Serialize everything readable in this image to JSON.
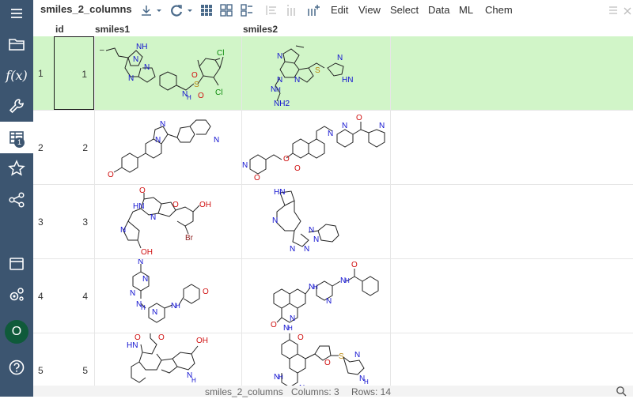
{
  "sidebar": {
    "items": [
      {
        "name": "menu-icon"
      },
      {
        "name": "folder-icon"
      },
      {
        "name": "function-icon",
        "label": "f(x)"
      },
      {
        "name": "wrench-icon"
      },
      {
        "name": "table-icon",
        "badge": "1"
      },
      {
        "name": "star-icon"
      },
      {
        "name": "share-icon"
      },
      {
        "name": "window-icon"
      },
      {
        "name": "settings-icon"
      },
      {
        "name": "avatar",
        "label": "O"
      },
      {
        "name": "help-icon"
      }
    ]
  },
  "toolbar": {
    "title": "smiles_2_columns",
    "menus": [
      "Edit",
      "View",
      "Select",
      "Data",
      "ML",
      "Chem"
    ]
  },
  "grid": {
    "columns": [
      "id",
      "smiles1",
      "smiles2"
    ],
    "rows": [
      {
        "num": "1",
        "id": "1"
      },
      {
        "num": "2",
        "id": "2"
      },
      {
        "num": "3",
        "id": "3"
      },
      {
        "num": "4",
        "id": "4"
      },
      {
        "num": "5",
        "id": "5"
      }
    ],
    "labels": {
      "r1a_me": "–",
      "r1a_cl1": "Cl",
      "r1a_cl2": "Cl",
      "r1a_nh": "NH",
      "r1a_o": "O",
      "r1a_s": "S",
      "r1a_n": "N",
      "r1a_h": "H",
      "r1b_nh2": "NH2",
      "r1b_hn": "HN",
      "r1b_s": "S",
      "r1b_n": "N",
      "r1b_h": "H",
      "r2a_o": "O",
      "r2a_n": "N",
      "r2b_o": "O",
      "r2b_n": "N",
      "r2b_h": "H",
      "r3a_hn": "HN",
      "r3a_o": "O",
      "r3a_oh1": "OH",
      "r3a_oh2": "OH",
      "r3a_br": "Br",
      "r3a_n": "N",
      "r3b_hn": "HN",
      "r3b_n": "N",
      "r4a_n": "N",
      "r4a_h": "H",
      "r4a_o": "O",
      "r4b_n": "N",
      "r4b_h": "H",
      "r4b_o": "O",
      "r5a_hn": "HN",
      "r5a_o": "O",
      "r5a_oh": "OH",
      "r5a_h": "H",
      "r5a_n": "N",
      "r5b_o": "O",
      "r5b_n": "N",
      "r5b_h": "H",
      "r5b_s": "S"
    }
  },
  "status": {
    "table": "smiles_2_columns",
    "columns": "Columns: 3",
    "rows": "Rows: 14"
  }
}
